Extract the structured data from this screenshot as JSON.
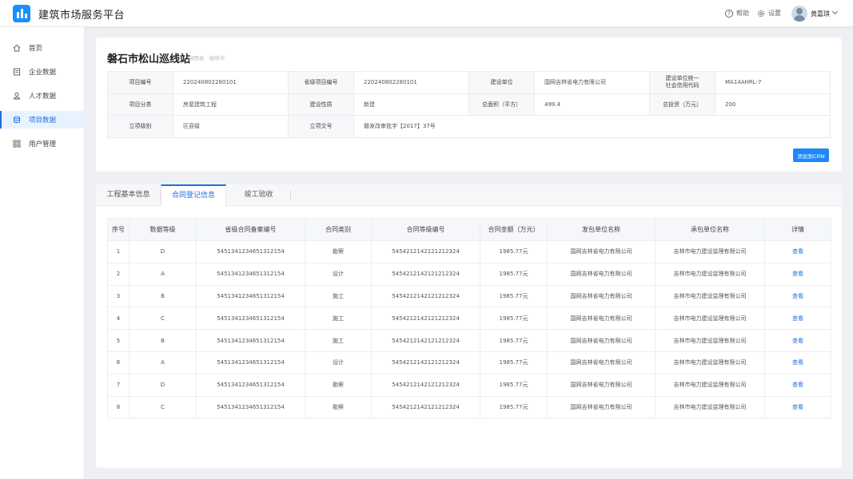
{
  "app": {
    "title": "建筑市场服务平台"
  },
  "header": {
    "help_label": "帮助",
    "settings_label": "设置",
    "user_name": "黄嘉琪"
  },
  "sidebar": {
    "items": [
      {
        "label": "首页",
        "icon": "home-icon"
      },
      {
        "label": "企业数据",
        "icon": "document-icon"
      },
      {
        "label": "人才数据",
        "icon": "person-icon"
      },
      {
        "label": "项目数据",
        "icon": "database-icon",
        "active": true
      },
      {
        "label": "用户管理",
        "icon": "grid-icon"
      }
    ]
  },
  "project": {
    "title": "磐石市松山巡线站",
    "location": "陕西省 · 榆林市",
    "info": [
      [
        "项目编号",
        "220240802280101",
        "省级项目编号",
        "220240802280101",
        "建设单位",
        "国网吉林省电力有限公司",
        "建设单位统一\n社会信用代码",
        "MA14AHRL-7"
      ],
      [
        "项目分类",
        "房屋建筑工程",
        "建设性质",
        "新建",
        "总面积（平方）",
        "499.4",
        "总投资（万元）",
        "200"
      ],
      [
        "立项级别",
        "区县级",
        "立项文号",
        "磐发改审批字【2017】37号",
        "",
        "",
        "",
        ""
      ]
    ],
    "crm_button": "添加到CRM"
  },
  "tabs": [
    {
      "label": "工程基本信息"
    },
    {
      "label": "合同登记信息",
      "active": true
    },
    {
      "label": "竣工验收"
    }
  ],
  "table": {
    "headers": [
      "序号",
      "数据等级",
      "省级合同备案编号",
      "合同类别",
      "合同等级编号",
      "合同金额（万元）",
      "发包单位名称",
      "承包单位名称",
      "详情"
    ],
    "rows": [
      [
        "1",
        "D",
        "5451341234651312154",
        "勘察",
        "5454212142121212324",
        "1985.77元",
        "国网吉林省电力有限公司",
        "吉林市电力建设监理有限公司",
        "查看"
      ],
      [
        "2",
        "A",
        "5451341234651312154",
        "设计",
        "5454212142121212324",
        "1985.77元",
        "国网吉林省电力有限公司",
        "吉林市电力建设监理有限公司",
        "查看"
      ],
      [
        "3",
        "B",
        "5451341234651312154",
        "施工",
        "5454212142121212324",
        "1985.77元",
        "国网吉林省电力有限公司",
        "吉林市电力建设监理有限公司",
        "查看"
      ],
      [
        "4",
        "C",
        "5451341234651312154",
        "施工",
        "5454212142121212324",
        "1985.77元",
        "国网吉林省电力有限公司",
        "吉林市电力建设监理有限公司",
        "查看"
      ],
      [
        "5",
        "B",
        "5451341234651312154",
        "施工",
        "5454212142121212324",
        "1985.77元",
        "国网吉林省电力有限公司",
        "吉林市电力建设监理有限公司",
        "查看"
      ],
      [
        "6",
        "A",
        "5451341234651312154",
        "设计",
        "5454212142121212324",
        "1985.77元",
        "国网吉林省电力有限公司",
        "吉林市电力建设监理有限公司",
        "查看"
      ],
      [
        "7",
        "D",
        "5451341234651312154",
        "勘察",
        "5454212142121212324",
        "1985.77元",
        "国网吉林省电力有限公司",
        "吉林市电力建设监理有限公司",
        "查看"
      ],
      [
        "8",
        "C",
        "5451341234651312154",
        "勘察",
        "5454212142121212324",
        "1985.77元",
        "国网吉林省电力有限公司",
        "吉林市电力建设监理有限公司",
        "查看"
      ]
    ]
  },
  "colors": {
    "accent": "#1e6fe0",
    "button": "#1e88f7",
    "background": "#eef0f3"
  }
}
